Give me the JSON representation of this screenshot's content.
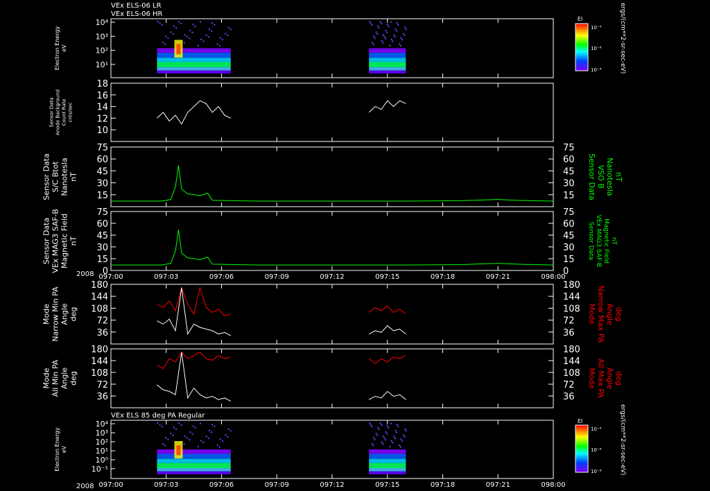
{
  "header": {
    "line1": "VEx ELS-06 LR",
    "line2": "VEx ELS-06 HR",
    "bottom_panel_title": "VEx ELS 85 deg PA Regular",
    "year_label": "2008"
  },
  "colors": {
    "background": "#000000",
    "axis": "#ffffff",
    "b_field": "#00ff00",
    "max_pa": "#ff0000",
    "min_pa": "#ffffff"
  },
  "colorbar": {
    "label": "El",
    "top_tick": "10⁻⁴",
    "mid_tick": "10⁻⁶",
    "bottom_tick": "10⁻⁸",
    "units": "ergs/(cm**2-sr-sec-eV)"
  },
  "time_axis": {
    "ticks": [
      "097:00",
      "097:03",
      "097:06",
      "097:09",
      "097:12",
      "097:15",
      "097:18",
      "097:21",
      "098:00"
    ]
  },
  "chart_data": [
    {
      "type": "heatmap",
      "panel": "electron-energy-top",
      "ylabel": [
        "Electron Energy",
        "eV"
      ],
      "yscale": "log",
      "ylim": [
        1,
        10000
      ],
      "yticks": [
        "10⁴",
        "10³",
        "10²",
        "10¹"
      ],
      "data_intervals": [
        [
          "097:02:30",
          "097:06:30"
        ],
        [
          "097:14:00",
          "097:16:00"
        ]
      ]
    },
    {
      "type": "line",
      "panel": "count-rate",
      "ylabel": [
        "Sensor Data",
        "Anode Background",
        "Count Rate",
        "cnts/sec"
      ],
      "ylim": [
        8,
        18
      ],
      "yticks": [
        18,
        16,
        14,
        12,
        10
      ],
      "series": [
        {
          "x": [
            "097:02:30",
            "097:02:50",
            "097:03:10",
            "097:03:30",
            "097:03:50",
            "097:04:10",
            "097:04:30",
            "097:04:50",
            "097:05:10",
            "097:05:30",
            "097:05:50",
            "097:06:10",
            "097:06:30"
          ],
          "values": [
            12,
            13,
            11.5,
            12.5,
            11,
            13,
            14,
            15,
            14.5,
            13,
            14,
            12.5,
            12
          ]
        },
        {
          "x": [
            "097:14:00",
            "097:14:20",
            "097:14:40",
            "097:15:00",
            "097:15:20",
            "097:15:40",
            "097:16:00"
          ],
          "values": [
            13,
            14,
            13.5,
            15,
            14,
            15,
            14.5
          ]
        }
      ]
    },
    {
      "type": "line",
      "panel": "bt-sc",
      "ylabel": [
        "Sensor Data",
        "S/C Btot",
        "Nanotesla",
        "nT"
      ],
      "right_label": [
        "Sensor Data",
        "VSO B",
        "Nanotesla",
        "nT"
      ],
      "ylim": [
        0,
        75
      ],
      "yticks": [
        75,
        60,
        45,
        30,
        15
      ],
      "series": [
        {
          "x": [
            "097:00",
            "097:02:45",
            "097:03:15",
            "097:03:30",
            "097:03:40",
            "097:03:50",
            "097:04:10",
            "097:04:50",
            "097:05:15",
            "097:05:30",
            "097:08",
            "097:12",
            "097:16",
            "097:19",
            "097:21",
            "097:22",
            "098:00"
          ],
          "values": [
            7,
            7,
            9,
            25,
            52,
            22,
            16,
            14,
            17,
            8,
            7,
            7,
            7,
            7.5,
            9,
            8,
            7
          ]
        }
      ]
    },
    {
      "type": "line",
      "panel": "bt-mag",
      "ylabel": [
        "Sensor Data",
        "VEx MAG3 SAF-B",
        "Magnetic Field",
        "nT"
      ],
      "right_label": [
        "Sensor Data",
        "VEx MAG3 SAF-B",
        "Magnetic Field",
        "nT"
      ],
      "ylim": [
        0,
        75
      ],
      "yticks": [
        75,
        60,
        45,
        30,
        15,
        0
      ],
      "series": [
        {
          "x": [
            "097:00",
            "097:02:45",
            "097:03:15",
            "097:03:30",
            "097:03:40",
            "097:03:50",
            "097:04:10",
            "097:04:50",
            "097:05:15",
            "097:05:30",
            "097:08",
            "097:12",
            "097:16",
            "097:19",
            "097:21",
            "097:22",
            "098:00"
          ],
          "values": [
            7,
            7,
            9,
            25,
            52,
            22,
            16,
            14,
            17,
            8,
            7,
            7,
            7,
            7.5,
            9,
            8,
            7
          ]
        }
      ]
    },
    {
      "type": "line",
      "panel": "narrow-pa",
      "ylabel": [
        "Mode",
        "Narrow Min PA",
        "Angle",
        "deg"
      ],
      "right_label": [
        "Mode",
        "Narrow Max PA",
        "Angle",
        "deg"
      ],
      "ylim": [
        0,
        180
      ],
      "yticks": [
        180,
        144,
        108,
        72,
        36
      ],
      "series": [
        {
          "name": "max",
          "x": [
            "097:02:30",
            "097:02:50",
            "097:03:10",
            "097:03:30",
            "097:03:50",
            "097:04:10",
            "097:04:30",
            "097:04:50",
            "097:05:10",
            "097:05:30",
            "097:05:50",
            "097:06:10",
            "097:06:30",
            "097:14:00",
            "097:14:20",
            "097:14:40",
            "097:15:00",
            "097:15:20",
            "097:15:40",
            "097:16:00"
          ],
          "values": [
            120,
            110,
            130,
            100,
            170,
            120,
            90,
            170,
            110,
            95,
            105,
            85,
            90,
            95,
            110,
            100,
            115,
            95,
            105,
            90
          ]
        },
        {
          "name": "min",
          "x": [
            "097:02:30",
            "097:02:50",
            "097:03:10",
            "097:03:30",
            "097:03:50",
            "097:04:10",
            "097:04:30",
            "097:04:50",
            "097:05:10",
            "097:05:30",
            "097:05:50",
            "097:06:10",
            "097:06:30",
            "097:14:00",
            "097:14:20",
            "097:14:40",
            "097:15:00",
            "097:15:20",
            "097:15:40",
            "097:16:00"
          ],
          "values": [
            70,
            60,
            75,
            40,
            170,
            30,
            60,
            50,
            45,
            40,
            30,
            35,
            25,
            30,
            40,
            35,
            55,
            40,
            45,
            30
          ]
        }
      ]
    },
    {
      "type": "line",
      "panel": "all-pa",
      "ylabel": [
        "Mode",
        "All Min PA",
        "Angle",
        "deg"
      ],
      "right_label": [
        "Mode",
        "All Max PA",
        "Angle",
        "deg"
      ],
      "ylim": [
        0,
        180
      ],
      "yticks": [
        180,
        144,
        108,
        72,
        36
      ],
      "series": [
        {
          "name": "max",
          "x": [
            "097:02:30",
            "097:02:50",
            "097:03:10",
            "097:03:30",
            "097:03:50",
            "097:04:10",
            "097:04:30",
            "097:04:50",
            "097:05:10",
            "097:05:30",
            "097:05:50",
            "097:06:10",
            "097:06:30",
            "097:14:00",
            "097:14:20",
            "097:14:40",
            "097:15:00",
            "097:15:20",
            "097:15:40",
            "097:16:00"
          ],
          "values": [
            130,
            120,
            150,
            140,
            170,
            150,
            160,
            170,
            150,
            145,
            160,
            150,
            155,
            150,
            135,
            150,
            140,
            155,
            150,
            160
          ]
        },
        {
          "name": "min",
          "x": [
            "097:02:30",
            "097:02:50",
            "097:03:10",
            "097:03:30",
            "097:03:50",
            "097:04:10",
            "097:04:30",
            "097:04:50",
            "097:05:10",
            "097:05:30",
            "097:05:50",
            "097:06:10",
            "097:06:30",
            "097:14:00",
            "097:14:20",
            "097:14:40",
            "097:15:00",
            "097:15:20",
            "097:15:40",
            "097:16:00"
          ],
          "values": [
            70,
            55,
            50,
            40,
            170,
            30,
            60,
            40,
            30,
            35,
            25,
            30,
            20,
            25,
            35,
            30,
            50,
            35,
            40,
            25
          ]
        }
      ]
    },
    {
      "type": "heatmap",
      "panel": "electron-energy-bottom",
      "ylabel": [
        "Electron Energy",
        "eV"
      ],
      "yscale": "log",
      "ylim": [
        0.1,
        10000
      ],
      "yticks": [
        "10⁴",
        "10³",
        "10²",
        "10¹",
        "10⁰",
        "10⁻¹"
      ],
      "data_intervals": [
        [
          "097:02:30",
          "097:06:30"
        ],
        [
          "097:14:00",
          "097:16:00"
        ]
      ]
    }
  ]
}
